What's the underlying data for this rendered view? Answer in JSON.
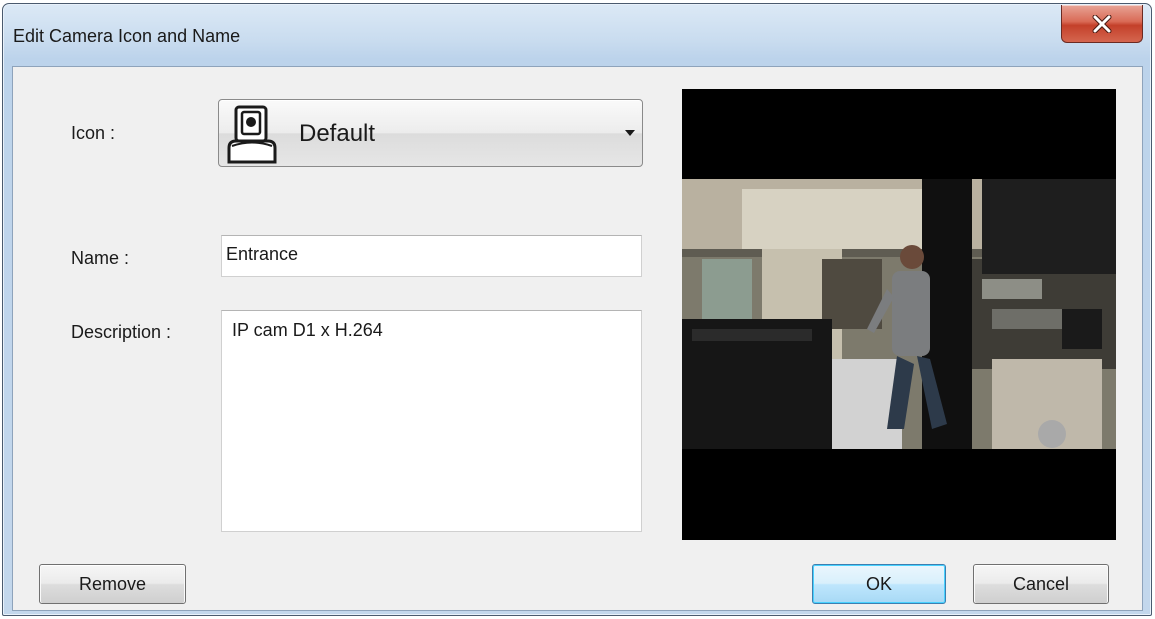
{
  "window": {
    "title": "Edit Camera Icon and Name",
    "close_icon": "close-x-icon"
  },
  "form": {
    "icon_label": "Icon :",
    "icon_value": "Default",
    "icon_glyph": "ptz-camera-icon",
    "name_label": "Name :",
    "name_value": "Entrance",
    "description_label": "Description :",
    "description_value": "IP cam D1 x H.264"
  },
  "preview": {
    "content": "camera-preview-image"
  },
  "buttons": {
    "remove": "Remove",
    "ok": "OK",
    "cancel": "Cancel"
  },
  "colors": {
    "close_button": "#c4402a",
    "ok_button_border": "#3c7fb1",
    "dialog_background": "#f0f0f0",
    "preview_background": "#000000"
  }
}
